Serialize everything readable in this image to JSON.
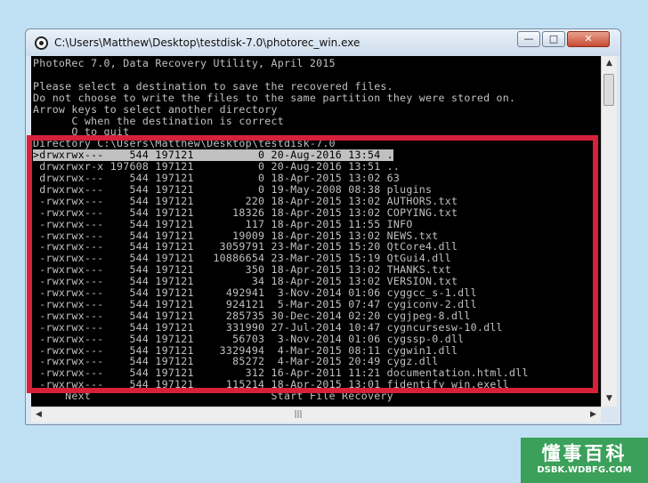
{
  "window": {
    "title": "C:\\Users\\Matthew\\Desktop\\testdisk-7.0\\photorec_win.exe",
    "minimize": "—",
    "maximize": "□",
    "close": "✕"
  },
  "console": {
    "lines": [
      "PhotoRec 7.0, Data Recovery Utility, April 2015",
      "",
      "Please select a destination to save the recovered files.",
      "Do not choose to write the files to the same partition they were stored on.",
      "Arrow keys to select another directory",
      "      C when the destination is correct",
      "      Q to quit",
      "Directory C:\\Users\\Matthew\\Desktop\\testdisk-7.0",
      ">drwxrwx---    544 197121          0 20-Aug-2016 13:54 .",
      " drwxrwxr-x 197608 197121          0 20-Aug-2016 13:51 ..",
      " drwxrwx---    544 197121          0 18-Apr-2015 13:02 63",
      " drwxrwx---    544 197121          0 19-May-2008 08:38 plugins",
      " -rwxrwx---    544 197121        220 18-Apr-2015 13:02 AUTHORS.txt",
      " -rwxrwx---    544 197121      18326 18-Apr-2015 13:02 COPYING.txt",
      " -rwxrwx---    544 197121        117 18-Apr-2015 11:55 INFO",
      " -rwxrwx---    544 197121      19009 18-Apr-2015 13:02 NEWS.txt",
      " -rwxrwx---    544 197121    3059791 23-Mar-2015 15:20 QtCore4.dll",
      " -rwxrwx---    544 197121   10886654 23-Mar-2015 15:19 QtGui4.dll",
      " -rwxrwx---    544 197121        350 18-Apr-2015 13:02 THANKS.txt",
      " -rwxrwx---    544 197121         34 18-Apr-2015 13:02 VERSION.txt",
      " -rwxrwx---    544 197121     492941  3-Nov-2014 01:06 cyggcc_s-1.dll",
      " -rwxrwx---    544 197121     924121  5-Mar-2015 07:47 cygiconv-2.dll",
      " -rwxrwx---    544 197121     285735 30-Dec-2014 02:20 cygjpeg-8.dll",
      " -rwxrwx---    544 197121     331990 27-Jul-2014 10:47 cygncursesw-10.dll",
      " -rwxrwx---    544 197121      56703  3-Nov-2014 01:06 cygssp-0.dll",
      " -rwxrwx---    544 197121    3329494  4-Mar-2015 08:11 cygwin1.dll",
      " -rwxrwx---    544 197121      85272  4-Mar-2015 20:49 cygz.dll",
      " -rwxrwx---    544 197121        312 16-Apr-2011 11:21 documentation.html.dll",
      " -rwxrwx---    544 197121     115214 18-Apr-2015 13:01 fidentify_win.exell",
      "     Next                            Start File Recovery"
    ],
    "selected_index": 8
  },
  "scrollbars": {
    "up": "▲",
    "down": "▼",
    "left": "◀",
    "right": "▶",
    "grip": "|||"
  },
  "watermark": {
    "chinese": "懂事百科",
    "site": "DSBK.WDBFG.COM"
  },
  "colors": {
    "highlight_border": "#d7213b",
    "console_bg": "#000000",
    "console_fg": "#c0c0c0",
    "watermark_bg": "#3aa05a"
  }
}
